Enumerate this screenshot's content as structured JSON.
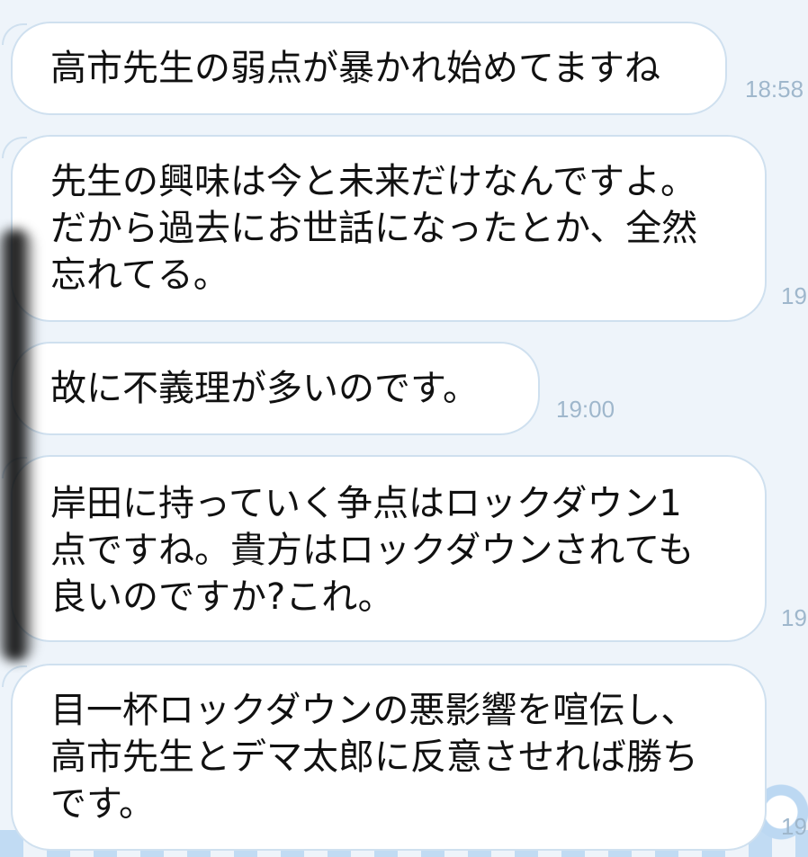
{
  "messages": [
    {
      "lines": [
        "高市先生の弱点が暴かれ始めてますね"
      ],
      "time": "18:58"
    },
    {
      "lines": [
        "先生の興味は今と未来だけなんですよ。",
        "だから過去にお世話になったとか、全然",
        "忘れてる。"
      ],
      "time": "19"
    },
    {
      "lines": [
        "故に不義理が多いのです。"
      ],
      "time": "19:00"
    },
    {
      "lines": [
        "岸田に持っていく争点はロックダウン1",
        "点ですね。貴方はロックダウンされても",
        "良いのですか?これ。"
      ],
      "time": "19"
    },
    {
      "lines": [
        "目一杯ロックダウンの悪影響を喧伝し、",
        "高市先生とデマ太郎に反意させれば勝ち",
        "です。"
      ],
      "time": "19"
    }
  ],
  "colors": {
    "background": "#eef4fa",
    "bubble": "#ffffff",
    "bubble_border": "#cfe0ef",
    "timestamp": "#9fb7cc"
  }
}
